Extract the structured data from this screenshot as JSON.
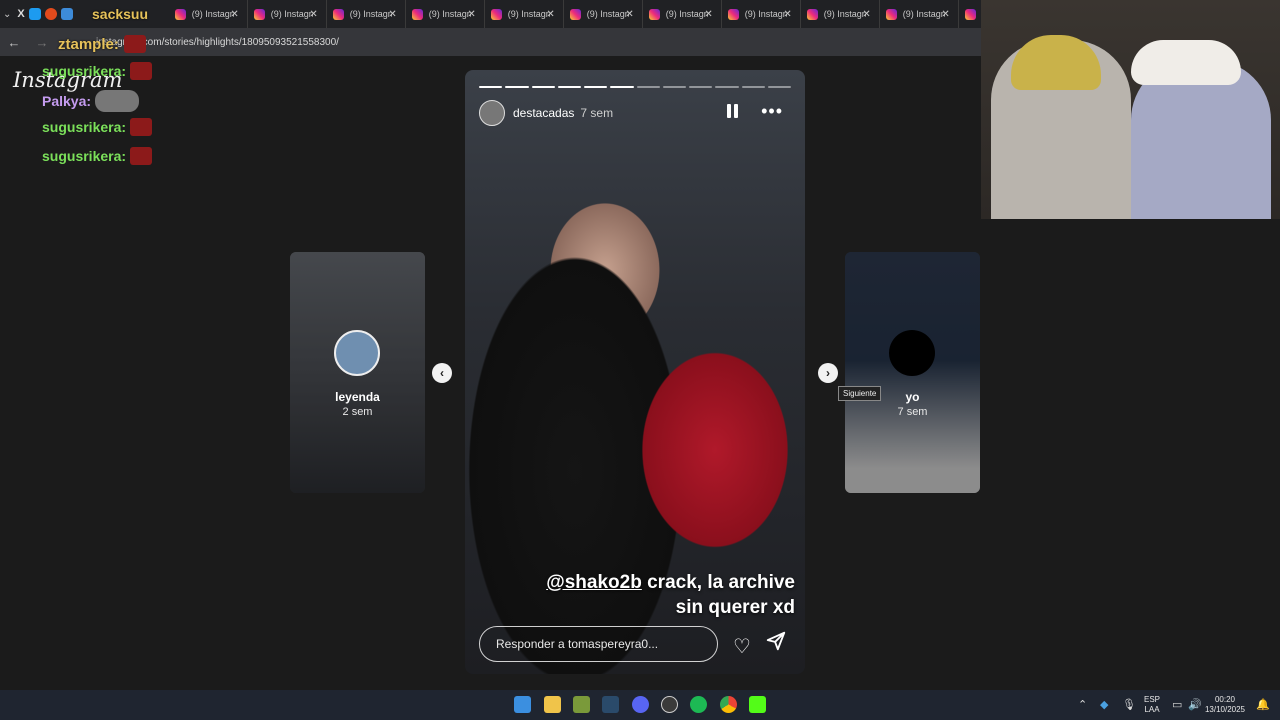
{
  "browser": {
    "overlay_tab_text": "sacksuu",
    "tabs": [
      {
        "label": "(9) Instagram"
      },
      {
        "label": "(9) Instagram"
      },
      {
        "label": "(9) Instagram"
      },
      {
        "label": "(9) Instagram"
      },
      {
        "label": "(9) Instagram"
      },
      {
        "label": "(9) Instagram"
      },
      {
        "label": "(9) Instagram"
      },
      {
        "label": "(9) Instagram"
      },
      {
        "label": "(9) Instagram"
      },
      {
        "label": "(9) Instagram"
      },
      {
        "label": "(9) Instagram"
      }
    ],
    "url": "instagram.com/stories/highlights/18095093521558300/"
  },
  "page": {
    "logo": "Instagram"
  },
  "stream_overlay": {
    "alert_user": "ztample:",
    "chat": [
      {
        "user": "sugusrikera:",
        "color": "#7be05a"
      },
      {
        "user": "Palkya:",
        "color": "#c59cf0"
      },
      {
        "user": "sugusrikera:",
        "color": "#7be05a"
      },
      {
        "user": "sugusrikera:",
        "color": "#7be05a"
      }
    ]
  },
  "story": {
    "username": "destacadas",
    "time": "7 sem",
    "segments_total": 12,
    "segments_done": 6,
    "caption_mention": "@shako2b",
    "caption_rest": " crack, la archive sin querer xd",
    "reply_placeholder": "Responder a tomaspereyra0..."
  },
  "previous_highlight": {
    "name": "leyenda",
    "time": "2 sem"
  },
  "next_highlight": {
    "name": "yo",
    "time": "7 sem",
    "tooltip": "Siguiente"
  },
  "taskbar": {
    "lang_top": "ESP",
    "lang_bottom": "LAA",
    "clock_time": "00:20",
    "clock_date": "13/10/2025"
  }
}
